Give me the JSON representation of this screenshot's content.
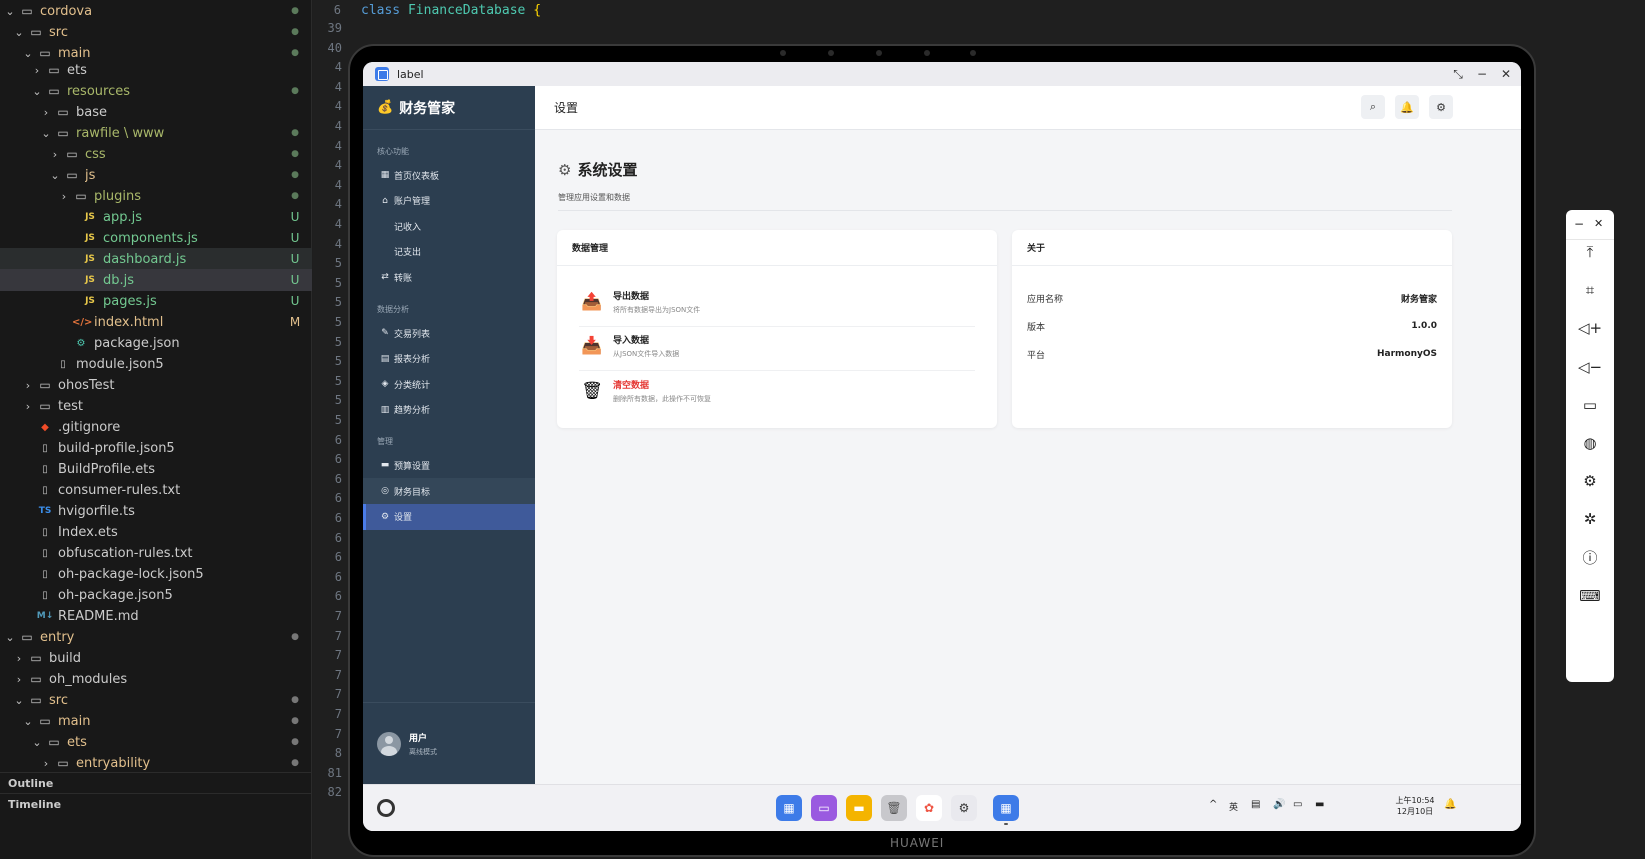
{
  "explorer": {
    "rows": [
      {
        "name": "cordova",
        "badge": "●"
      },
      {
        "name": "src",
        "badge": "●"
      },
      {
        "name": "main",
        "badge": "●"
      },
      {
        "name": "ets",
        "badge": ""
      },
      {
        "name": "resources",
        "badge": "●"
      },
      {
        "name": "base",
        "badge": ""
      },
      {
        "name": "rawfile \\ www",
        "badge": "●"
      },
      {
        "name": "css",
        "badge": "●"
      },
      {
        "name": "js",
        "badge": "●"
      },
      {
        "name": "plugins",
        "badge": "●"
      },
      {
        "name": "app.js",
        "badge": "U",
        "icon": "JS"
      },
      {
        "name": "components.js",
        "badge": "U",
        "icon": "JS"
      },
      {
        "name": "dashboard.js",
        "badge": "U",
        "icon": "JS"
      },
      {
        "name": "db.js",
        "badge": "U",
        "icon": "JS"
      },
      {
        "name": "pages.js",
        "badge": "U",
        "icon": "JS"
      },
      {
        "name": "index.html",
        "badge": "M",
        "icon": "</>"
      },
      {
        "name": "package.json",
        "badge": "",
        "icon": "⚙"
      },
      {
        "name": "module.json5",
        "badge": ""
      },
      {
        "name": "ohosTest",
        "badge": ""
      },
      {
        "name": "test",
        "badge": ""
      },
      {
        "name": ".gitignore",
        "badge": "",
        "icon": "◆"
      },
      {
        "name": "build-profile.json5",
        "badge": ""
      },
      {
        "name": "BuildProfile.ets",
        "badge": ""
      },
      {
        "name": "consumer-rules.txt",
        "badge": ""
      },
      {
        "name": "hvigorfile.ts",
        "badge": "",
        "icon": "TS"
      },
      {
        "name": "Index.ets",
        "badge": ""
      },
      {
        "name": "obfuscation-rules.txt",
        "badge": ""
      },
      {
        "name": "oh-package-lock.json5",
        "badge": ""
      },
      {
        "name": "oh-package.json5",
        "badge": ""
      },
      {
        "name": "README.md",
        "badge": "",
        "icon": "M↓"
      },
      {
        "name": "entry",
        "badge": "●"
      },
      {
        "name": "build",
        "badge": ""
      },
      {
        "name": "oh_modules",
        "badge": ""
      },
      {
        "name": "src",
        "badge": "●"
      },
      {
        "name": "main",
        "badge": "●"
      },
      {
        "name": "ets",
        "badge": "●"
      },
      {
        "name": "entryability",
        "badge": "●"
      }
    ],
    "outline_label": "Outline",
    "timeline_label": "Timeline"
  },
  "editor": {
    "line6_num": "6",
    "line6_keyword": "class",
    "line6_class": "FinanceDatabase",
    "line6_brace": "{",
    "line_numbers": [
      "39",
      "40",
      "4",
      "4",
      "4",
      "4",
      "4",
      "4",
      "4",
      "4",
      "4",
      "4",
      "5",
      "5",
      "5",
      "5",
      "5",
      "5",
      "5",
      "5",
      "5",
      "6",
      "6",
      "6",
      "6",
      "6",
      "6",
      "6",
      "6",
      "6",
      "7",
      "7",
      "7",
      "7",
      "7",
      "7",
      "7",
      "8",
      "81",
      "82"
    ]
  },
  "device": {
    "brand": "HUAWEI",
    "window_title": "label",
    "window_controls": {
      "restore": "⤡",
      "minimize": "−",
      "close": "✕"
    }
  },
  "app": {
    "logo_icon": "💰",
    "name": "财务管家",
    "sections": [
      {
        "title": "核心功能",
        "items": [
          {
            "icon": "▦",
            "label": "首页仪表板"
          },
          {
            "icon": "⌂",
            "label": "账户管理"
          },
          {
            "icon": "",
            "label": "记收入"
          },
          {
            "icon": "",
            "label": "记支出"
          },
          {
            "icon": "⇄",
            "label": "转账"
          }
        ]
      },
      {
        "title": "数据分析",
        "items": [
          {
            "icon": "✎",
            "label": "交易列表"
          },
          {
            "icon": "▤",
            "label": "报表分析"
          },
          {
            "icon": "◈",
            "label": "分类统计"
          },
          {
            "icon": "▥",
            "label": "趋势分析"
          }
        ]
      },
      {
        "title": "管理",
        "items": [
          {
            "icon": "▬",
            "label": "预算设置"
          },
          {
            "icon": "◎",
            "label": "财务目标"
          },
          {
            "icon": "⚙",
            "label": "设置"
          }
        ]
      }
    ],
    "user": {
      "name": "用户",
      "status": "离线模式"
    }
  },
  "header": {
    "title": "设置",
    "search_icon": "⌕",
    "bell_icon": "🔔",
    "settings_icon": "⚙"
  },
  "page": {
    "title": "系统设置",
    "subtitle": "管理应用设置和数据"
  },
  "data_card": {
    "title": "数据管理",
    "actions": [
      {
        "icon": "📤",
        "title": "导出数据",
        "desc": "将所有数据导出为JSON文件",
        "danger": false
      },
      {
        "icon": "📥",
        "title": "导入数据",
        "desc": "从JSON文件导入数据",
        "danger": false
      },
      {
        "icon": "🗑",
        "title": "清空数据",
        "desc": "删除所有数据，此操作不可恢复",
        "danger": true
      }
    ]
  },
  "about_card": {
    "title": "关于",
    "rows": [
      {
        "key": "应用名称",
        "value": "财务管家"
      },
      {
        "key": "版本",
        "value": "1.0.0"
      },
      {
        "key": "平台",
        "value": "HarmonyOS"
      }
    ]
  },
  "taskbar": {
    "tray": {
      "ime": "英",
      "caret": "^",
      "volume": "🔊"
    },
    "clock_time": "上午10:54",
    "clock_date": "12月10日"
  },
  "emulator_toolbar": {
    "min": "−",
    "close": "✕",
    "buttons": [
      "⤒",
      "⌗",
      "◁+",
      "◁−",
      "▭",
      "◍",
      "⚙",
      "✲",
      "ⓘ",
      "⌨"
    ]
  },
  "colors": {
    "sidebar": "#2c3e50",
    "active_nav": "#3f5a9a",
    "danger": "#e53935",
    "untracked": "#73c991",
    "modified": "#e2c08d"
  }
}
